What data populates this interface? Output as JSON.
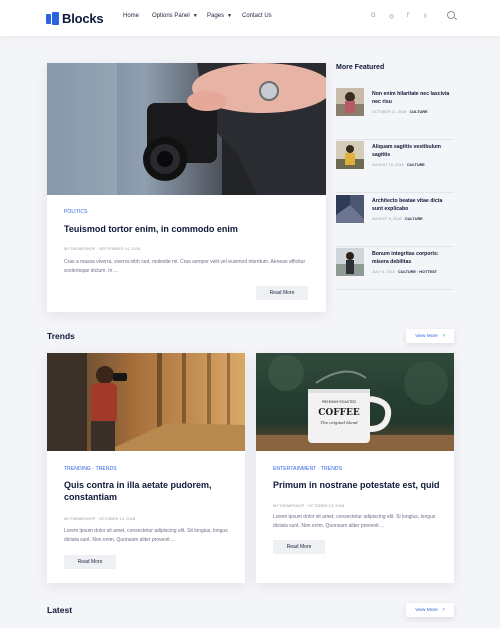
{
  "brand": {
    "name": "Blocks",
    "accent": "#2a63e0"
  },
  "nav": {
    "items": [
      {
        "label": "Home"
      },
      {
        "label": "Options Panel"
      },
      {
        "label": "Pages"
      },
      {
        "label": "Contact Us"
      }
    ]
  },
  "social": [
    "G",
    "◎",
    "f",
    "𝕥"
  ],
  "featured": {
    "category": "POLITICS",
    "title": "Teuismod tortor enim, in commodo enim",
    "meta": "MYTHEMESHOP · SEPTEMBER 14, 2018",
    "excerpt": "Cras a massa viverra, viverra nibh sed, molestie mi. Cras semper velit vel euismod interdum. Aenean efficitur scelerisque dictum. In ...",
    "button": "Read More"
  },
  "sidebar": {
    "heading": "More Featured",
    "items": [
      {
        "title": "Non enim hilaritate nec lascivia nec risu",
        "date": "OCTOBER 11, 2018 ·",
        "category": "CULTURE"
      },
      {
        "title": "Aliquam sagittis vestibulum sagittis",
        "date": "AUGUST 10, 2018 ·",
        "category": "CULTURE"
      },
      {
        "title": "Architecto beatae vitae dicta sunt explicabo",
        "date": "AUGUST 8, 2018 ·",
        "category": "CULTURE"
      },
      {
        "title": "Bonum integritas corporis: misera debilitas",
        "date": "JULY 6, 2018 ·",
        "category": "CULTURE · HOTTEST"
      }
    ]
  },
  "trends": {
    "heading": "Trends",
    "view_more": "View More",
    "cards": [
      {
        "category": "TRENDING · TRENDS",
        "title": "Quis contra in illa aetate pudorem, constantiam",
        "meta": "MYTHEMESHOP · OCTOBER 14, 2018",
        "excerpt": "Lorem ipsum dolor sit amet, consectetur adipiscing elit. Sit longius, longus dictata sunt. Non enim. Quonsam aliter provenit ...",
        "button": "Read More"
      },
      {
        "category": "ENTERTAINMENT · TRENDS",
        "title": "Primum in nostrane potestate est, quid",
        "meta": "MYTHEMESHOP · OCTOBER 13, 2018",
        "excerpt": "Lorem ipsum dolor sit amet, consectetur adipiscing elit. Si longius, longus dictata sunt. Non enim. Quonsam aliter provenit ...",
        "button": "Read More",
        "mug_text_top": "PREMIUM ROASTED",
        "mug_text_main": "COFFEE",
        "mug_text_script": "The original blend"
      }
    ]
  },
  "latest": {
    "heading": "Latest",
    "view_more": "View More"
  }
}
